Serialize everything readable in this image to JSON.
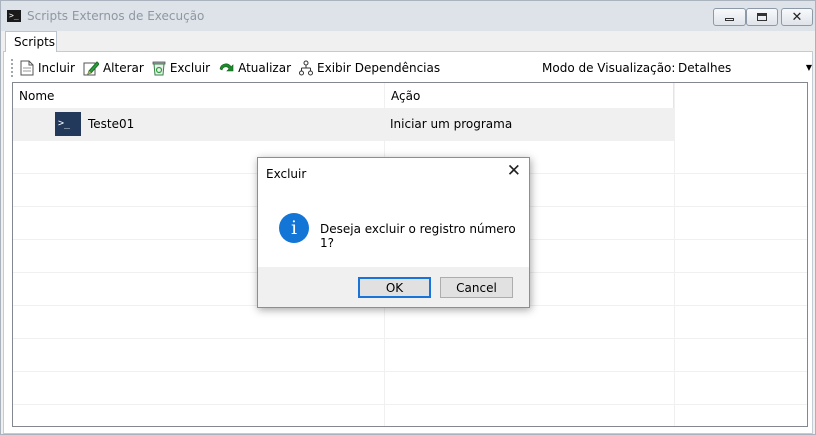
{
  "window": {
    "title": "Scripts Externos de Execução",
    "app_icon_glyph": ">_"
  },
  "tabs": [
    {
      "label": "Scripts"
    }
  ],
  "toolbar": {
    "items": [
      {
        "label": "Incluir",
        "icon": "document-icon"
      },
      {
        "label": "Alterar",
        "icon": "edit-pencil-icon"
      },
      {
        "label": "Excluir",
        "icon": "trash-icon"
      },
      {
        "label": "Atualizar",
        "icon": "refresh-icon"
      },
      {
        "label": "Exibir Dependências",
        "icon": "dependency-tree-icon"
      }
    ],
    "view_mode_label": "Modo de Visualização:",
    "view_mode_value": "Detalhes"
  },
  "list": {
    "columns": [
      "Nome",
      "Ação"
    ],
    "rows": [
      {
        "name": "Teste01",
        "action": "Iniciar um programa",
        "icon_glyph": ">_"
      }
    ]
  },
  "dialog": {
    "title": "Excluir",
    "message": "Deseja excluir o registro número 1?",
    "ok_label": "OK",
    "cancel_label": "Cancel",
    "icon": "info-icon",
    "icon_glyph": "i"
  },
  "colors": {
    "info_blue": "#1375d6",
    "focus_blue": "#1a73d9",
    "titlebar": "#dee3ea",
    "row_icon_bg": "#23395b"
  }
}
